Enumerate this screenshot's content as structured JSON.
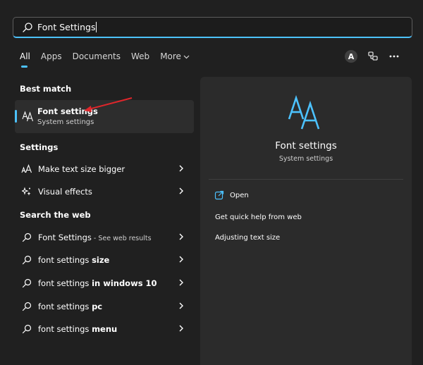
{
  "search": {
    "query": "Font Settings"
  },
  "tabs": [
    {
      "label": "All"
    },
    {
      "label": "Apps"
    },
    {
      "label": "Documents"
    },
    {
      "label": "Web"
    },
    {
      "label": "More"
    }
  ],
  "header_right": {
    "avatar_letter": "A"
  },
  "sections": {
    "best_match": "Best match",
    "settings": "Settings",
    "search_web": "Search the web"
  },
  "best_match": {
    "title": "Font settings",
    "subtitle": "System settings"
  },
  "settings_items": [
    {
      "label": "Make text size bigger"
    },
    {
      "label": "Visual effects"
    }
  ],
  "web_items": [
    {
      "prefix": "Font Settings",
      "bold": "",
      "suffix": " - See web results"
    },
    {
      "prefix": "font settings ",
      "bold": "size",
      "suffix": ""
    },
    {
      "prefix": "font settings ",
      "bold": "in windows 10",
      "suffix": ""
    },
    {
      "prefix": "font settings ",
      "bold": "pc",
      "suffix": ""
    },
    {
      "prefix": "font settings ",
      "bold": "menu",
      "suffix": ""
    }
  ],
  "detail": {
    "title": "Font settings",
    "subtitle": "System settings",
    "open_label": "Open",
    "actions": [
      "Get quick help from web",
      "Adjusting text size"
    ]
  },
  "colors": {
    "accent": "#4cc2ff",
    "annotation_arrow": "#e0262b"
  }
}
